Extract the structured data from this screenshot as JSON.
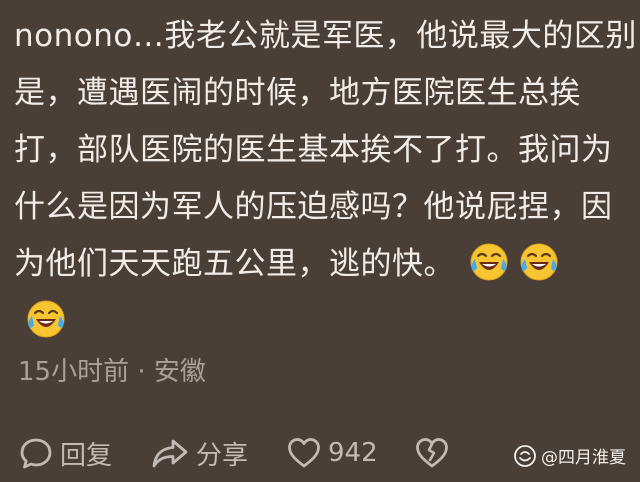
{
  "comment": {
    "lines": [
      "nonono…我老公就是军医，他说最大的区别",
      "是，遭遇医闹的时候，地方医院医生总挨",
      "打，部队医院的医生基本挨不了打。我问为",
      "什么是因为军人的压迫感吗？他说屁捏，因",
      "为他们天天跑五公里，逃的快。"
    ],
    "emoji": "laughing-crying-emoji"
  },
  "meta": {
    "time": "15小时前",
    "separator": "·",
    "location": "安徽"
  },
  "actions": {
    "reply_label": "回复",
    "share_label": "分享",
    "like_count": "942"
  },
  "watermark": {
    "text": "@四月淮夏"
  },
  "colors": {
    "background": "#4a3f37",
    "text": "#f1ece7",
    "muted": "#a8a09a"
  }
}
